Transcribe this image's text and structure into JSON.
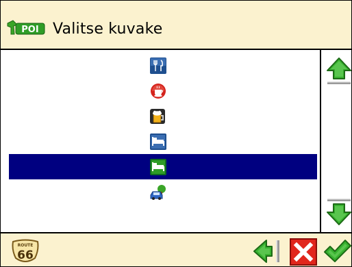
{
  "header": {
    "logo_icon": "poi-logo-icon",
    "logo_text": "POI",
    "title": "Valitse kuvake"
  },
  "list": {
    "selected_index": 4,
    "items": [
      {
        "icon": "restaurant-icon"
      },
      {
        "icon": "cafe-icon"
      },
      {
        "icon": "pub-icon"
      },
      {
        "icon": "hotel-icon"
      },
      {
        "icon": "hotel-icon"
      },
      {
        "icon": "parking-icon"
      }
    ]
  },
  "scroll": {
    "up_icon": "arrow-up-icon",
    "down_icon": "arrow-down-icon"
  },
  "footer": {
    "route_badge_icon": "route-66-icon",
    "route_top_text": "ROUTE",
    "route_number": "66",
    "back_icon": "back-arrow-icon",
    "cancel_icon": "cancel-icon",
    "ok_icon": "checkmark-icon"
  },
  "colors": {
    "panel_bg": "#fbf2cf",
    "selection": "#000080",
    "accent_green": "#2f9d27",
    "cancel_red": "#e1261c"
  }
}
